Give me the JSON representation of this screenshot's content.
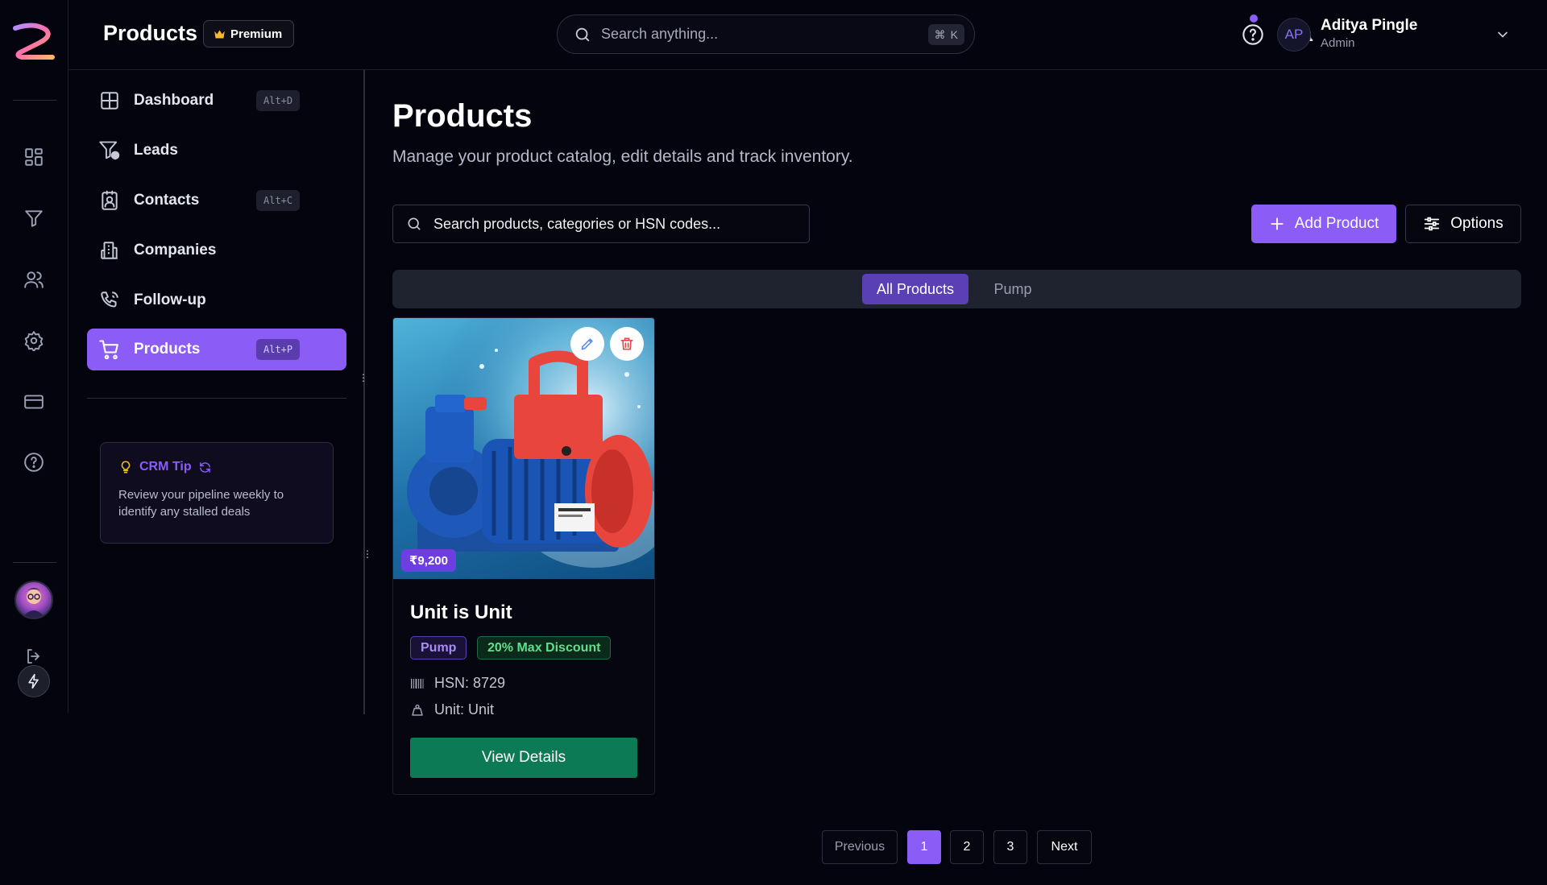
{
  "header": {
    "title": "Products",
    "premium_label": "Premium",
    "search_placeholder": "Search anything...",
    "search_shortcut": "K",
    "user": {
      "initials": "AP",
      "name": "Aditya Pingle",
      "role": "Admin"
    }
  },
  "rail": {
    "icons": [
      "logo-icon",
      "dashboard-icon",
      "filter-icon",
      "users-icon",
      "settings-icon",
      "card-icon",
      "help-icon",
      "logout-icon",
      "bolt-icon"
    ]
  },
  "sidebar": {
    "items": [
      {
        "label": "Dashboard",
        "shortcut": "Alt+D",
        "icon": "dashboard-icon"
      },
      {
        "label": "Leads",
        "shortcut": "",
        "icon": "leads-funnel-icon"
      },
      {
        "label": "Contacts",
        "shortcut": "Alt+C",
        "icon": "contacts-icon"
      },
      {
        "label": "Companies",
        "shortcut": "",
        "icon": "building-icon"
      },
      {
        "label": "Follow-up",
        "shortcut": "",
        "icon": "phone-icon"
      },
      {
        "label": "Products",
        "shortcut": "Alt+P",
        "icon": "cart-icon",
        "active": true
      }
    ],
    "tip": {
      "title": "CRM Tip",
      "text": "Review your pipeline weekly to identify any stalled deals"
    }
  },
  "main": {
    "title": "Products",
    "subtitle": "Manage your product catalog, edit details and track inventory.",
    "search_placeholder": "Search products, categories or HSN codes...",
    "add_label": "Add Product",
    "options_label": "Options",
    "tabs": [
      {
        "label": "All Products",
        "active": true
      },
      {
        "label": "Pump",
        "active": false
      }
    ],
    "products": [
      {
        "price": "₹9,200",
        "name": "Unit is Unit",
        "category": "Pump",
        "discount": "20% Max Discount",
        "hsn": "HSN: 8729",
        "unit": "Unit: Unit",
        "button": "View Details"
      }
    ],
    "pagination": {
      "previous": "Previous",
      "pages": [
        "1",
        "2",
        "3"
      ],
      "current": "1",
      "next": "Next"
    }
  },
  "colors": {
    "accent": "#8b5cf6",
    "success": "#0b7a55",
    "background": "#03040d"
  }
}
